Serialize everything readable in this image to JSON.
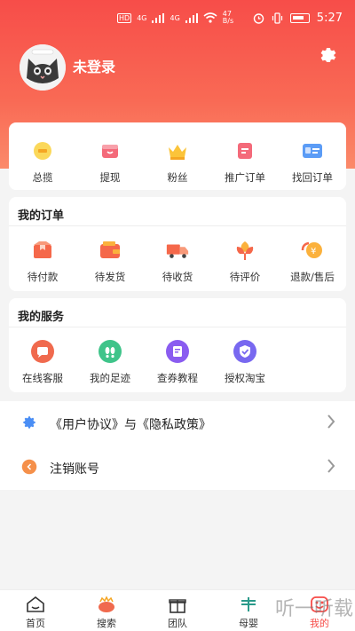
{
  "status_bar": {
    "speed": "47\nB/s",
    "time": "5:27",
    "net1": "4G",
    "net2": "4G"
  },
  "header": {
    "login_text": "未登录"
  },
  "quick_menu": [
    {
      "label": "总揽",
      "icon": "coin-icon",
      "color": "#f5b428"
    },
    {
      "label": "提现",
      "icon": "wallet-icon",
      "color": "#f25a6b"
    },
    {
      "label": "粉丝",
      "icon": "crown-icon",
      "color": "#f5b428"
    },
    {
      "label": "推广订单",
      "icon": "doc-icon",
      "color": "#f25a6b"
    },
    {
      "label": "找回订单",
      "icon": "id-card-icon",
      "color": "#4a8ef5"
    }
  ],
  "orders": {
    "title": "我的订单",
    "items": [
      {
        "label": "待付款",
        "icon": "box-icon"
      },
      {
        "label": "待发货",
        "icon": "wallet-icon"
      },
      {
        "label": "待收货",
        "icon": "truck-icon"
      },
      {
        "label": "待评价",
        "icon": "flower-icon"
      },
      {
        "label": "退款/售后",
        "icon": "refund-icon"
      }
    ]
  },
  "services": {
    "title": "我的服务",
    "items": [
      {
        "label": "在线客服",
        "icon": "chat-icon",
        "color": "#f06a4e"
      },
      {
        "label": "我的足迹",
        "icon": "footprint-icon",
        "color": "#3fc48a"
      },
      {
        "label": "查券教程",
        "icon": "book-icon",
        "color": "#8a5cf0"
      },
      {
        "label": "授权淘宝",
        "icon": "shield-icon",
        "color": "#7868f0"
      }
    ]
  },
  "list": [
    {
      "label": "《用户协议》与《隐私政策》",
      "icon": "gear-icon"
    },
    {
      "label": "注销账号",
      "icon": "logout-icon"
    }
  ],
  "tabs": [
    {
      "label": "首页",
      "icon": "home-icon"
    },
    {
      "label": "搜索",
      "icon": "search-icon"
    },
    {
      "label": "团队",
      "icon": "gift-icon"
    },
    {
      "label": "母婴",
      "icon": "baby-icon"
    },
    {
      "label": "我的",
      "icon": "user-icon",
      "active": true
    }
  ],
  "watermark": "听一听载",
  "colors": {
    "brand": "#f74d49",
    "background": "#f4f4f4"
  }
}
